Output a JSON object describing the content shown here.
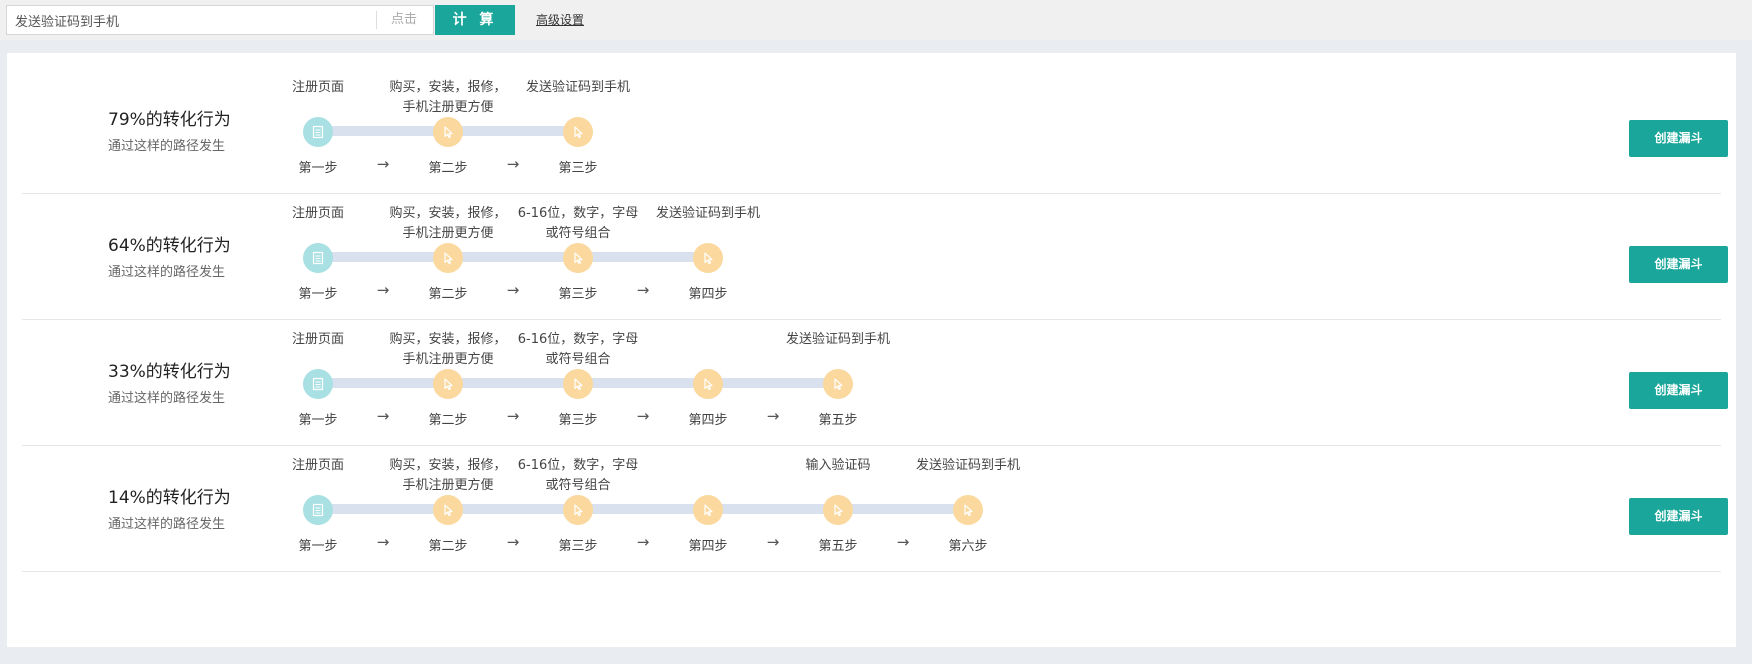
{
  "toolbar": {
    "search_value": "发送验证码到手机",
    "search_hint": "点击",
    "calc_label": "计 算",
    "advanced_label": "高级设置"
  },
  "rows": [
    {
      "rate": "79%的转化行为",
      "subtitle": "通过这样的路径发生",
      "button": "创建漏斗",
      "steps": [
        {
          "title": [
            "注册页面"
          ],
          "label": "第一步",
          "icon": "page-icon"
        },
        {
          "title": [
            "购买，安装，报修，",
            "手机注册更方便"
          ],
          "label": "第二步",
          "icon": "cursor-icon"
        },
        {
          "title": [
            "发送验证码到手机"
          ],
          "label": "第三步",
          "icon": "cursor-icon"
        }
      ]
    },
    {
      "rate": "64%的转化行为",
      "subtitle": "通过这样的路径发生",
      "button": "创建漏斗",
      "steps": [
        {
          "title": [
            "注册页面"
          ],
          "label": "第一步",
          "icon": "page-icon"
        },
        {
          "title": [
            "购买，安装，报修，",
            "手机注册更方便"
          ],
          "label": "第二步",
          "icon": "cursor-icon"
        },
        {
          "title": [
            "6-16位，数字，字母",
            "或符号组合"
          ],
          "label": "第三步",
          "icon": "cursor-icon"
        },
        {
          "title": [
            "发送验证码到手机"
          ],
          "label": "第四步",
          "icon": "cursor-icon"
        }
      ]
    },
    {
      "rate": "33%的转化行为",
      "subtitle": "通过这样的路径发生",
      "button": "创建漏斗",
      "steps": [
        {
          "title": [
            "注册页面"
          ],
          "label": "第一步",
          "icon": "page-icon"
        },
        {
          "title": [
            "购买，安装，报修，",
            "手机注册更方便"
          ],
          "label": "第二步",
          "icon": "cursor-icon"
        },
        {
          "title": [
            "6-16位，数字，字母",
            "或符号组合"
          ],
          "label": "第三步",
          "icon": "cursor-icon"
        },
        {
          "title": [],
          "label": "第四步",
          "icon": "cursor-icon"
        },
        {
          "title": [
            "发送验证码到手机"
          ],
          "label": "第五步",
          "icon": "cursor-icon"
        }
      ]
    },
    {
      "rate": "14%的转化行为",
      "subtitle": "通过这样的路径发生",
      "button": "创建漏斗",
      "steps": [
        {
          "title": [
            "注册页面"
          ],
          "label": "第一步",
          "icon": "page-icon"
        },
        {
          "title": [
            "购买，安装，报修，",
            "手机注册更方便"
          ],
          "label": "第二步",
          "icon": "cursor-icon"
        },
        {
          "title": [
            "6-16位，数字，字母",
            "或符号组合"
          ],
          "label": "第三步",
          "icon": "cursor-icon"
        },
        {
          "title": [],
          "label": "第四步",
          "icon": "cursor-icon"
        },
        {
          "title": [
            "输入验证码"
          ],
          "label": "第五步",
          "icon": "cursor-icon"
        },
        {
          "title": [
            "发送验证码到手机"
          ],
          "label": "第六步",
          "icon": "cursor-icon"
        }
      ]
    }
  ],
  "arrow_glyph": "→",
  "colors": {
    "accent": "#1aa69a",
    "start_node": "#a9e0e3",
    "click_node": "#fad89e",
    "track": "#d9e1ef"
  }
}
